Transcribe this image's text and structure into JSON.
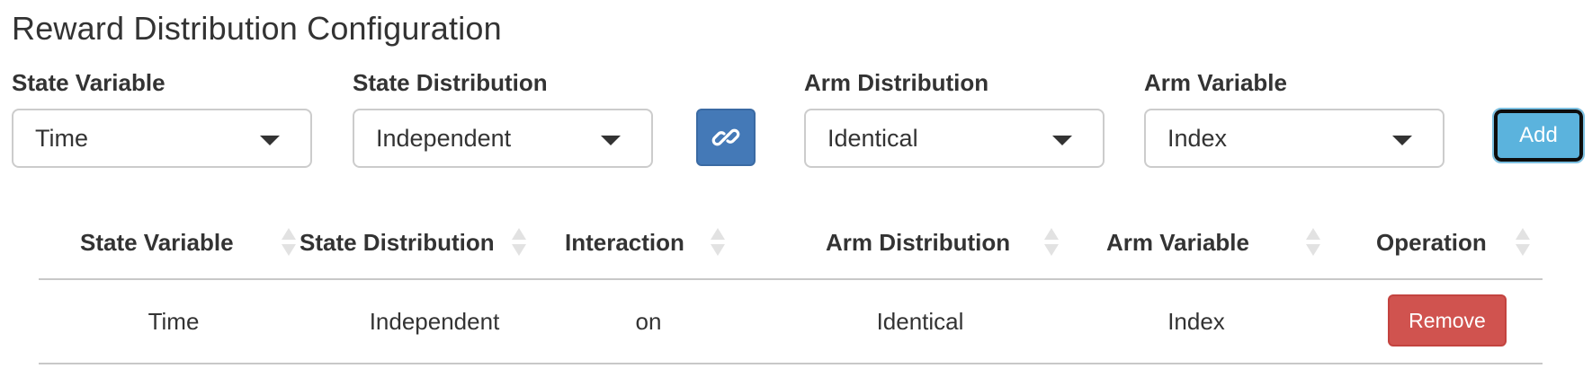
{
  "page_title": "Reward Distribution Configuration",
  "form": {
    "state_variable": {
      "label": "State Variable",
      "value": "Time"
    },
    "state_distribution": {
      "label": "State Distribution",
      "value": "Independent"
    },
    "link_icon": "link-icon",
    "arm_distribution": {
      "label": "Arm Distribution",
      "value": "Identical"
    },
    "arm_variable": {
      "label": "Arm Variable",
      "value": "Index"
    },
    "add_label": "Add"
  },
  "table": {
    "headers": [
      "State Variable",
      "State Distribution",
      "Interaction",
      "Arm Distribution",
      "Arm Variable",
      "Operation"
    ],
    "rows": [
      {
        "state_variable": "Time",
        "state_distribution": "Independent",
        "interaction": "on",
        "arm_distribution": "Identical",
        "arm_variable": "Index",
        "operation_label": "Remove"
      }
    ]
  },
  "colors": {
    "primary": "#4479b7",
    "info": "#5bb3dd",
    "danger": "#d0534f"
  }
}
